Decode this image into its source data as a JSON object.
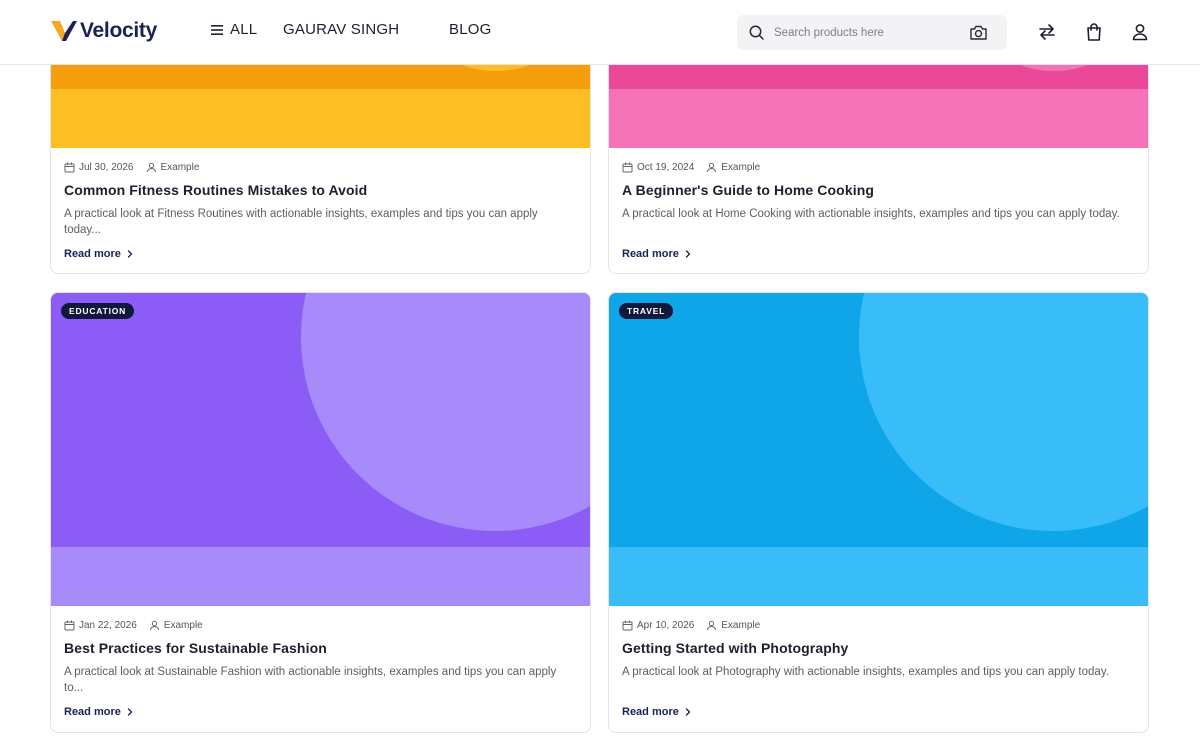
{
  "header": {
    "logo_text": "Velocity",
    "nav": {
      "all": "ALL",
      "user": "GAURAV SINGH",
      "blog": "BLOG"
    },
    "search": {
      "placeholder": "Search products here",
      "value": ""
    },
    "icons": [
      "search-icon",
      "camera-icon",
      "swap-icon",
      "bag-icon",
      "user-icon"
    ]
  },
  "posts": [
    {
      "date": "Jul 30, 2026",
      "author": "Example",
      "title": "Common Fitness Routines Mistakes to Avoid",
      "excerpt": "A practical look at Fitness Routines with actionable insights, examples and tips you can apply today...",
      "read_more": "Read more",
      "colors": {
        "base": "#f59e0b",
        "circle": "#fbbf24",
        "band": "#fbbf24"
      }
    },
    {
      "date": "Oct 19, 2024",
      "author": "Example",
      "title": "A Beginner's Guide to Home Cooking",
      "excerpt": "A practical look at Home Cooking with actionable insights, examples and tips you can apply today.",
      "read_more": "Read more",
      "colors": {
        "base": "#ec4899",
        "circle": "#f472b6",
        "band": "#f472b6"
      }
    },
    {
      "badge": "EDUCATION",
      "date": "Jan 22, 2026",
      "author": "Example",
      "title": "Best Practices for Sustainable Fashion",
      "excerpt": "A practical look at Sustainable Fashion with actionable insights, examples and tips you can apply to...",
      "read_more": "Read more",
      "colors": {
        "base": "#8b5cf6",
        "circle": "#a78bfa",
        "band": "#a78bfa"
      }
    },
    {
      "badge": "TRAVEL",
      "date": "Apr 10, 2026",
      "author": "Example",
      "title": "Getting Started with Photography",
      "excerpt": "A practical look at Photography with actionable insights, examples and tips you can apply today.",
      "read_more": "Read more",
      "colors": {
        "base": "#0ea5e9",
        "circle": "#38bdf8",
        "band": "#38bdf8"
      }
    }
  ]
}
